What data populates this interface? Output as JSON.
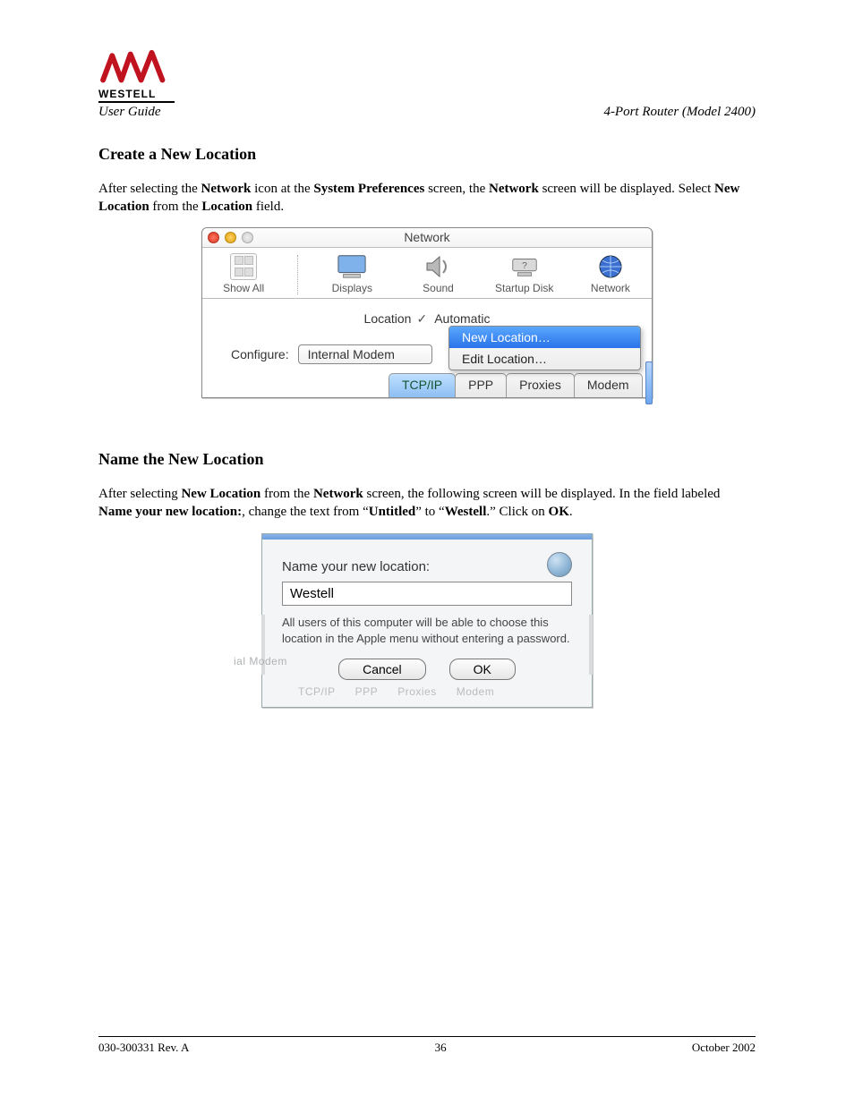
{
  "header": {
    "brand": "WESTELL",
    "left": "User Guide",
    "right": "4-Port Router (Model 2400)"
  },
  "section1": {
    "title": "Create a New Location",
    "p_pre1": "After selecting the ",
    "p_b1": "Network",
    "p_mid1": " icon at the ",
    "p_b2": "System Preferences",
    "p_mid2": " screen, the ",
    "p_b3": "Network",
    "p_mid3": " screen will be displayed. Select ",
    "p_b4": "New Location",
    "p_mid4": " from the ",
    "p_b5": "Location",
    "p_post": " field."
  },
  "netwin": {
    "title": "Network",
    "prefs": {
      "showall": "Show All",
      "displays": "Displays",
      "sound": "Sound",
      "startup": "Startup Disk",
      "network": "Network"
    },
    "location_label": "Location",
    "location_current": "Automatic",
    "location_menu": {
      "new": "New Location…",
      "edit": "Edit Location…"
    },
    "configure_label": "Configure:",
    "configure_value": "Internal Modem",
    "tabs": {
      "tcpip": "TCP/IP",
      "ppp": "PPP",
      "proxies": "Proxies",
      "modem": "Modem"
    }
  },
  "section2": {
    "title": "Name the New Location",
    "p_pre1": "After selecting ",
    "p_b1": "New Location",
    "p_mid1": " from the ",
    "p_b2": "Network",
    "p_mid2": " screen, the following screen will be displayed. In the field labeled ",
    "p_b3": "Name your new location:",
    "p_mid3": ", change the text from “",
    "p_b4": "Untitled",
    "p_mid4": "” to “",
    "p_b5": "Westell",
    "p_mid5": ".” Click on ",
    "p_b6": "OK",
    "p_post": "."
  },
  "namwin": {
    "prompt": "Name your new location:",
    "value": "Westell",
    "note": "All users of this computer will be able to choose this location in the Apple menu without entering a password.",
    "cancel": "Cancel",
    "ok": "OK",
    "ghost_configure": "ial Modem",
    "ghost_tabs": {
      "tcpip": "TCP/IP",
      "ppp": "PPP",
      "proxies": "Proxies",
      "modem": "Modem"
    }
  },
  "footer": {
    "left": "030-300331 Rev. A",
    "center": "36",
    "right": "October 2002"
  }
}
